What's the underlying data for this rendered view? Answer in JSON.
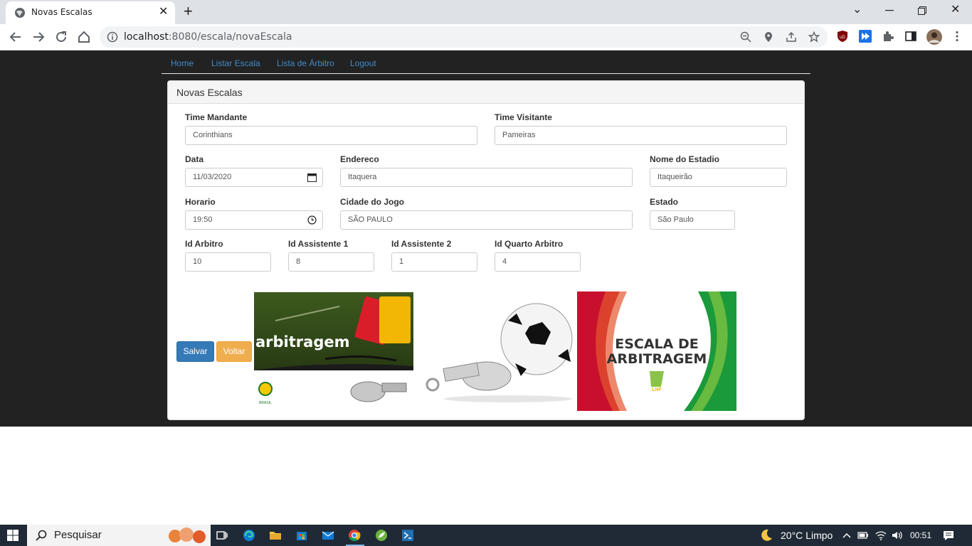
{
  "browser": {
    "tab_title": "Novas Escalas",
    "url_host": "localhost",
    "url_rest": ":8080/escala/novaEscala"
  },
  "nav": {
    "home": "Home",
    "listar_escala": "Listar Escala",
    "lista_arbitro": "Lista de Árbitro",
    "logout": "Logout"
  },
  "panel": {
    "title": "Novas Escalas"
  },
  "form": {
    "time_mandante": {
      "label": "Time Mandante",
      "value": "Corinthians"
    },
    "time_visitante": {
      "label": "Time Visitante",
      "value": "Pameiras"
    },
    "data": {
      "label": "Data",
      "value": "11/03/2020"
    },
    "endereco": {
      "label": "Endereco",
      "value": "Itaquera"
    },
    "nome_estadio": {
      "label": "Nome do Estadio",
      "value": "Itaqueirão"
    },
    "horario": {
      "label": "Horario",
      "value": "19:50"
    },
    "cidade": {
      "label": "Cidade do Jogo",
      "value": "SÃO PAULO"
    },
    "estado": {
      "label": "Estado",
      "value": "São Paulo"
    },
    "id_arbitro": {
      "label": "Id Arbitro",
      "value": "10"
    },
    "id_assistente1": {
      "label": "Id Assistente 1",
      "value": "8"
    },
    "id_assistente2": {
      "label": "Id Assistente 2",
      "value": "1"
    },
    "id_quarto": {
      "label": "Id Quarto Arbitro",
      "value": "4"
    }
  },
  "buttons": {
    "salvar": "Salvar",
    "voltar": "Voltar"
  },
  "images": {
    "img1_text": "arbitragem",
    "img1_badge": "BRASIL",
    "img3_line1": "ESCALA DE",
    "img3_line2": "ARBITRAGEM",
    "img3_logo": "LNF"
  },
  "taskbar": {
    "search_placeholder": "Pesquisar",
    "weather": "20°C  Limpo",
    "time": "00:51"
  },
  "colors": {
    "page_background": "#222222",
    "link": "#428bca",
    "primary": "#337ab7",
    "warning": "#f0ad4e"
  }
}
